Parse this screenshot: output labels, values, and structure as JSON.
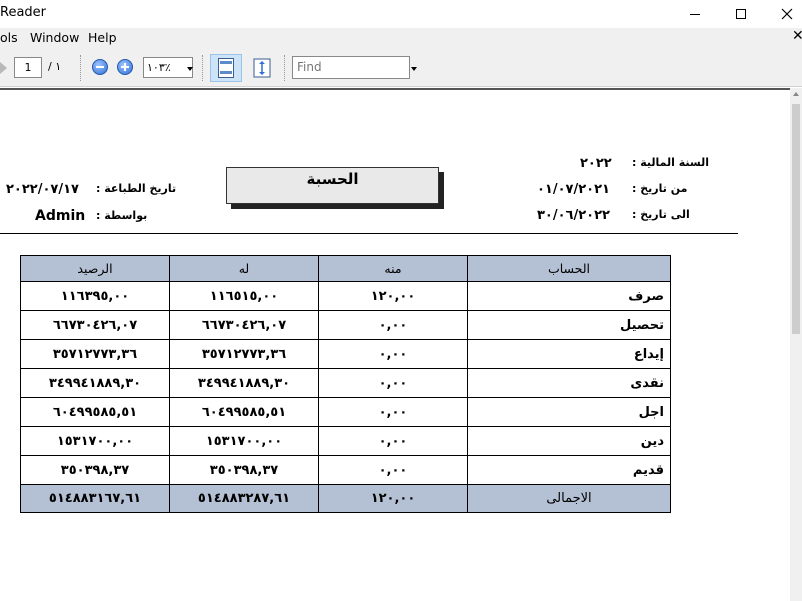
{
  "window": {
    "title": "Reader",
    "controls": {
      "min_icon": "minimize-icon",
      "max_icon": "maximize-icon",
      "close_icon": "close-icon",
      "close_glyph": "✕"
    }
  },
  "menu": {
    "items": [
      "ols",
      "Window",
      "Help"
    ],
    "doc_close_glyph": "✕"
  },
  "toolbar": {
    "page_value": "1",
    "page_total": "/ ١",
    "zoom_value": "١٠٣٪",
    "find_placeholder": "Find"
  },
  "report": {
    "title": "الحسبة",
    "fiscal_year_label": "السنة المالية :",
    "fiscal_year_value": "٢٠٢٢",
    "from_label": "من تاريخ :",
    "from_value": "٠١/٠٧/٢٠٢١",
    "to_label": "الى تاريخ :",
    "to_value": "٣٠/٠٦/٢٠٢٢",
    "print_date_label": "تاريخ الطباعة :",
    "print_date_value": "٢٠٢٢/٠٧/١٧",
    "by_label": "بواسطة :",
    "by_value": "Admin",
    "table": {
      "headers": [
        "الحساب",
        "منه",
        "له",
        "الرصيد"
      ],
      "rows": [
        [
          "صرف",
          "١٢٠,٠٠",
          "١١٦٥١٥,٠٠",
          "١١٦٣٩٥,٠٠"
        ],
        [
          "تحصيل",
          "٠,٠٠",
          "٦٦٧٣٠٤٢٦,٠٧",
          "٦٦٧٣٠٤٢٦,٠٧"
        ],
        [
          "إيداع",
          "٠,٠٠",
          "٣٥٧١٢٧٧٣,٣٦",
          "٣٥٧١٢٧٧٣,٣٦"
        ],
        [
          "نقدى",
          "٠,٠٠",
          "٣٤٩٩٤١٨٨٩,٣٠",
          "٣٤٩٩٤١٨٨٩,٣٠"
        ],
        [
          "اجل",
          "٠,٠٠",
          "٦٠٤٩٩٥٨٥,٥١",
          "٦٠٤٩٩٥٨٥,٥١"
        ],
        [
          "دين",
          "٠,٠٠",
          "١٥٣١٧٠٠,٠٠",
          "١٥٣١٧٠٠,٠٠"
        ],
        [
          "قديم",
          "٠,٠٠",
          "٣٥٠٣٩٨,٣٧",
          "٣٥٠٣٩٨,٣٧"
        ]
      ],
      "total": [
        "الاجمالى",
        "١٢٠,٠٠",
        "٥١٤٨٨٣٢٨٧,٦١",
        "٥١٤٨٨٣١٦٧,٦١"
      ]
    }
  },
  "colors": {
    "table_header_bg": "#b4c0d3",
    "title_box_bg": "#e9e9e9"
  }
}
